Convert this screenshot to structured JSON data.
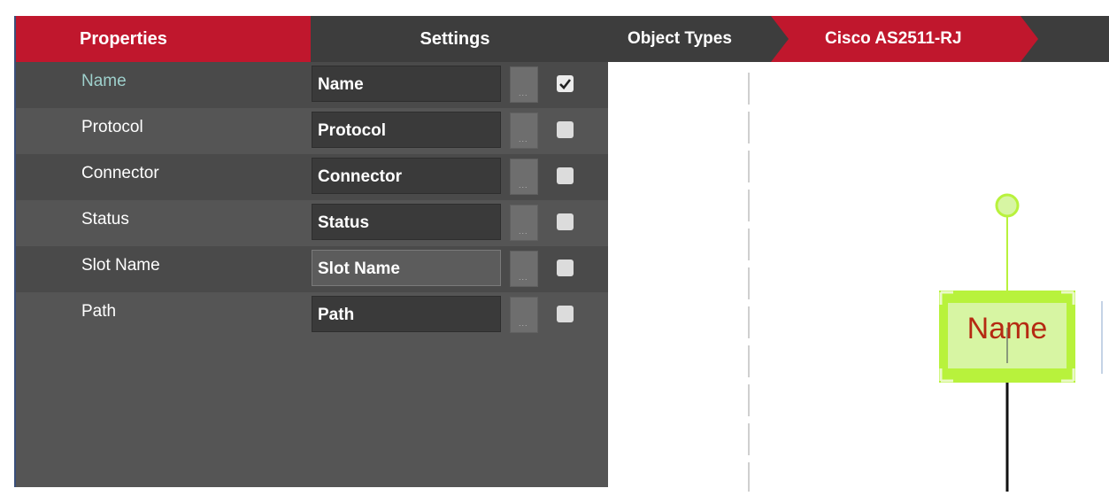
{
  "tabs": {
    "properties": "Properties",
    "settings": "Settings"
  },
  "rows": [
    {
      "label": "Name",
      "value": "Name",
      "dots": "...",
      "checked": true
    },
    {
      "label": "Protocol",
      "value": "Protocol",
      "dots": "...",
      "checked": false
    },
    {
      "label": "Connector",
      "value": "Connector",
      "dots": "...",
      "checked": false
    },
    {
      "label": "Status",
      "value": "Status",
      "dots": "...",
      "checked": false
    },
    {
      "label": "Slot Name",
      "value": "Slot Name",
      "dots": "...",
      "checked": false
    },
    {
      "label": "Path",
      "value": "Path",
      "dots": "...",
      "checked": false
    }
  ],
  "breadcrumb": {
    "root": "Object Types",
    "current": "Cisco AS2511-RJ"
  },
  "canvas": {
    "label_text": "Name",
    "colors": {
      "handle": "#b8f23c",
      "label_fill": "#d7f5a3",
      "label_text": "#b52a12",
      "link": "#111111"
    }
  },
  "colors": {
    "accent": "#c0172d",
    "panel": "#555555",
    "panel_dark": "#3d3d3d"
  }
}
